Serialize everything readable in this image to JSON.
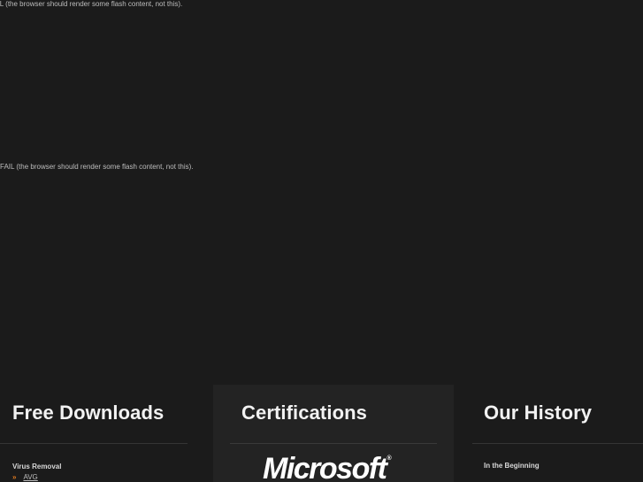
{
  "flash_messages": [
    "UL (the browser should render some flash content, not this).",
    "FAIL (the browser should render some flash content, not this)."
  ],
  "downloads": {
    "title": "Free Downloads",
    "subhead": "Virus Removal",
    "items": [
      {
        "label": "AVG"
      }
    ],
    "bullet": "»"
  },
  "certifications": {
    "title": "Certifications",
    "logo_text": "Microsoft",
    "logo_mark": "®"
  },
  "history": {
    "title": "Our History",
    "subhead": "In the Beginning"
  },
  "colors": {
    "background": "#1b1b1b",
    "panel": "#232323",
    "accent_bullet": "#e07a1f"
  }
}
